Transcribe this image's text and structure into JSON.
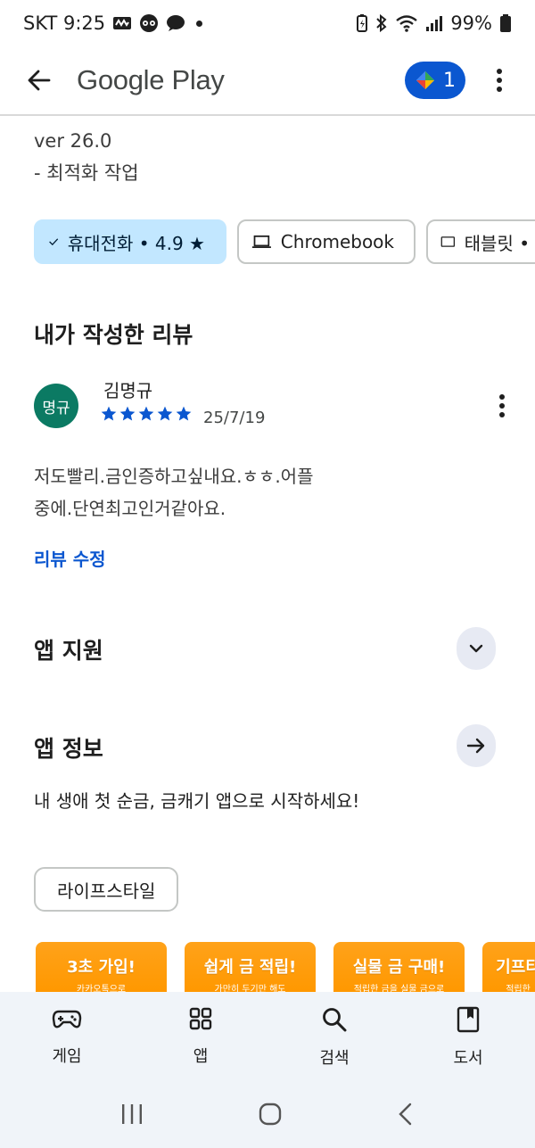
{
  "status_bar": {
    "carrier_time": "SKT 9:25",
    "battery": "99%"
  },
  "app_bar": {
    "title": "Google Play",
    "points_count": "1"
  },
  "whats_new": {
    "version": "ver 26.0",
    "note": "- 최적화 작업"
  },
  "device_chips": [
    {
      "label": "휴대전화 • 4.9 ★",
      "selected": true
    },
    {
      "label": "Chromebook",
      "selected": false
    },
    {
      "label": "태블릿 •",
      "selected": false
    }
  ],
  "my_review": {
    "section_title": "내가 작성한 리뷰",
    "avatar_text": "명규",
    "reviewer": "김명규",
    "rating": 5,
    "date": "25/7/19",
    "text": "저도빨리.금인증하고싶내요.ㅎㅎ.어플중에.단연최고인거같아요.",
    "edit_label": "리뷰 수정"
  },
  "app_support": {
    "title": "앱 지원"
  },
  "app_info": {
    "title": "앱 정보",
    "description": "내 생애 첫 순금, 금캐기 앱으로 시작하세요!",
    "category": "라이프스타일"
  },
  "screenshots": [
    {
      "title": "3초 가입!",
      "subtitle": "카카오톡으로"
    },
    {
      "title": "쉽게 금 적립!",
      "subtitle": "가만히 두기만 해도"
    },
    {
      "title": "실물 금 구매!",
      "subtitle": "적립한 금을 실물 금으로"
    },
    {
      "title": "기프티",
      "subtitle": "적립한"
    }
  ],
  "bottom_nav": [
    {
      "label": "게임",
      "icon": "gamepad-icon"
    },
    {
      "label": "앱",
      "icon": "apps-grid-icon"
    },
    {
      "label": "검색",
      "icon": "search-icon"
    },
    {
      "label": "도서",
      "icon": "book-icon"
    }
  ],
  "colors": {
    "accent": "#0b57d0",
    "chip_selected": "#c2e7ff",
    "avatar": "#0b7a63",
    "star": "#0b57d0",
    "screenshot": "#ff9800"
  }
}
